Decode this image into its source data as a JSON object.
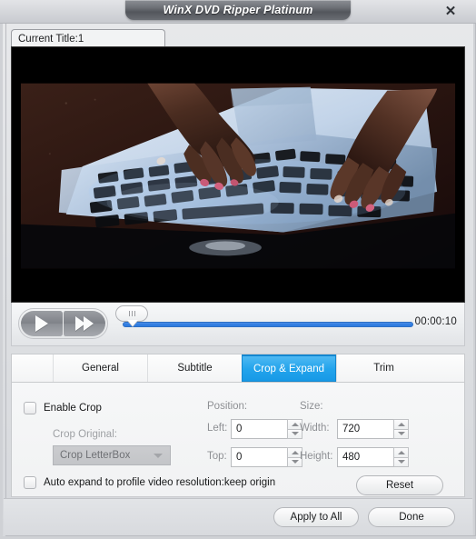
{
  "window": {
    "title": "WinX DVD Ripper Platinum",
    "close_label": "✕"
  },
  "title_tab": {
    "label": "Current Title:1"
  },
  "player": {
    "play_icon": "play-icon",
    "forward_icon": "fast-forward-icon",
    "time": "00:00:10",
    "seek_position_percent": 2
  },
  "video": {
    "description": "Hands typing on a backlit MacBook keyboard, letterboxed"
  },
  "tabs": [
    {
      "label": "General",
      "active": false
    },
    {
      "label": "Subtitle",
      "active": false
    },
    {
      "label": "Crop & Expand",
      "active": true
    },
    {
      "label": "Trim",
      "active": false
    }
  ],
  "crop": {
    "enable_crop_label": "Enable Crop",
    "enable_crop_checked": false,
    "crop_original_label": "Crop Original:",
    "crop_mode_value": "Crop LetterBox",
    "auto_expand_label": "Auto expand to profile video resolution:keep origin",
    "auto_expand_checked": false,
    "position_group_label": "Position:",
    "size_group_label": "Size:",
    "left_label": "Left:",
    "left_value": "0",
    "top_label": "Top:",
    "top_value": "0",
    "width_label": "Width:",
    "width_value": "720",
    "height_label": "Height:",
    "height_value": "480",
    "reset_label": "Reset"
  },
  "footer": {
    "apply_to_all_label": "Apply to All",
    "done_label": "Done"
  },
  "colors": {
    "accent_blue": "#23a4ec",
    "seek_blue": "#2f7ce0",
    "panel_bg": "#f1f2f3",
    "window_bg": "#dfe1e4"
  }
}
